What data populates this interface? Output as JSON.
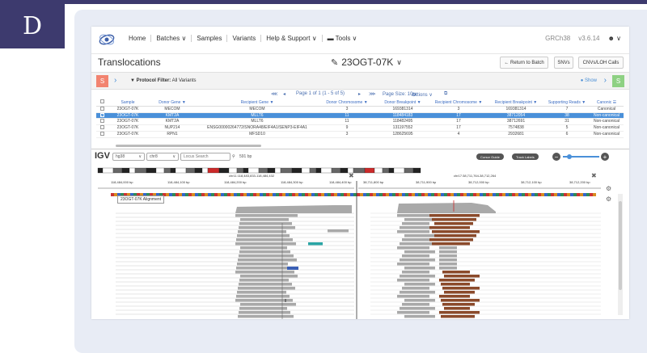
{
  "figure_label": "D",
  "nav": {
    "items": [
      "Home",
      "Batches ∨",
      "Samples",
      "Variants",
      "Help & Support ∨",
      "▬ Tools ∨"
    ],
    "genome": "GRCh38",
    "version": "v3.6.14",
    "user_icon": "user-icon"
  },
  "title": {
    "page": "Translocations",
    "sample": "23OGT-07K",
    "sample_chevron": "∨",
    "buttons": {
      "return": "← Return to Batch",
      "snvs": "SNVs",
      "cnvs": "CNVs/LOH Calls"
    }
  },
  "filter": {
    "left_btn": "S",
    "right_btn": "S",
    "label": "Protocol Filter:",
    "value": "All Variants",
    "show": "Show"
  },
  "pager": {
    "first": "⋘",
    "prev": "◂",
    "info": "Page 1 of 1 (1 - 5 of 5)",
    "next": "▸",
    "last": "⋙",
    "page_size": "Page Size: 10 ∨",
    "actions": "Actions ∨"
  },
  "table": {
    "headers": [
      "",
      "Sample",
      "Donor Gene ▼",
      "Recipient Gene ▼",
      "Donor Chromosome ▼",
      "Donor Breakpoint ▼",
      "Recipient Chromosome ▼",
      "Recipient Breakpoint ▼",
      "Supporting Reads ▼",
      "Canonic"
    ],
    "rows": [
      [
        "23OGT-07K",
        "MECOM",
        "MECOM",
        "3",
        "169381314",
        "3",
        "169381314",
        "7",
        "Canonical"
      ],
      [
        "23OGT-07K",
        "KMT2A",
        "MLLT6",
        "11",
        "118484183",
        "17",
        "38712054",
        "38",
        "Non-canonical"
      ],
      [
        "23OGT-07K",
        "KMT2A",
        "MLLT6",
        "11",
        "118482495",
        "17",
        "38712691",
        "31",
        "Non-canonical"
      ],
      [
        "23OGT-07K",
        "NUP214",
        "ENSG00000264772/SNORA48/EIF4A1/SENP3-EIF4A1",
        "9",
        "131197552",
        "17",
        "7574838",
        "5",
        "Non-canonical"
      ],
      [
        "23OGT-07K",
        "RPN1",
        "MFSD10",
        "3",
        "128625695",
        "4",
        "2932681",
        "6",
        "Non-canonical"
      ]
    ],
    "selected_row": 1
  },
  "igv": {
    "logo": "IGV",
    "genome": "hg38",
    "chrom": "chr8",
    "locus_placeholder": "Locus Search",
    "width_label": "591 bp",
    "cursor_guide": "Cursor Guide",
    "track_labels": "Track Labels",
    "minus": "−",
    "plus": "+",
    "locus_left": "chr11:118,483,833-118,484,432",
    "locus_right": "chr17:38,711,764-38,712,264",
    "ruler_left": [
      "118,484,000 bp",
      "118,484,100 bp",
      "118,484,200 bp",
      "118,484,300 bp",
      "118,484,400 bp"
    ],
    "ruler_right": [
      "38,711,800 bp",
      "38,711,900 bp",
      "38,712,000 bp",
      "38,712,100 bp",
      "38,712,200 bp"
    ],
    "alignment_track": "23OGT-07K Alignment"
  },
  "colors": {
    "dark_header": "#3d3a6e",
    "panel_bg": "#e8ecf5",
    "selected_row": "#4a90d9",
    "read_gray": "#a9a9a9",
    "read_brown": "#8b4a2b",
    "read_teal": "#2aa5a5",
    "read_blue": "#3a5fb5"
  }
}
